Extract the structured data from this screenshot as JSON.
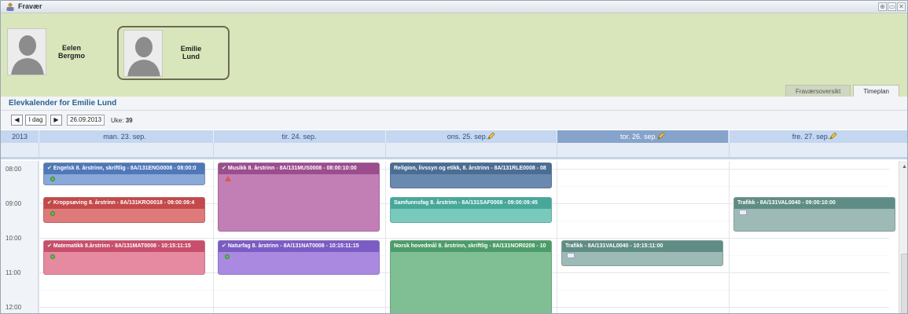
{
  "window": {
    "title": "Fravær",
    "buttons": [
      "⊕",
      "▭",
      "✕"
    ]
  },
  "students": [
    {
      "first": "Eelen",
      "last": "Bergmo"
    },
    {
      "first": "Emilie",
      "last": "Lund"
    }
  ],
  "tabs": [
    {
      "label": "Fraværsoversikt",
      "active": false
    },
    {
      "label": "Timeplan",
      "active": true
    }
  ],
  "calendar": {
    "title": "Elevkalender for Emilie Lund",
    "prev_icon": "◀",
    "today_label": "I dag",
    "next_icon": "▶",
    "date_value": "26.09.2013",
    "week_label": "Uke:",
    "week_number": "39",
    "year": "2013",
    "days": [
      {
        "label": "man. 23. sep.",
        "edit": false,
        "selected": false
      },
      {
        "label": "tir. 24. sep.",
        "edit": false,
        "selected": false
      },
      {
        "label": "ons. 25. sep.",
        "edit": true,
        "selected": false
      },
      {
        "label": "tor. 26. sep.",
        "edit": true,
        "selected": true
      },
      {
        "label": "fre. 27. sep.",
        "edit": true,
        "selected": false
      }
    ],
    "times": [
      "08:00",
      "09:00",
      "10:00",
      "11:00",
      "12:00"
    ]
  },
  "events": [
    {
      "day": 0,
      "start": "08:00",
      "end": "08:40",
      "check": true,
      "icon": "status-ok",
      "title": "Engelsk 8. årstrinn, skriftlig - 8A/131ENG0008 - 08:00:0",
      "bar": "#4f78b8",
      "body": "#8aa8d8"
    },
    {
      "day": 0,
      "start": "09:00",
      "end": "09:45",
      "check": true,
      "icon": "status-ok",
      "title": "Kroppsøving 8. årstrinn - 8A/131KRO0018 - 09:00:09:4",
      "bar": "#c4494a",
      "body": "#df7a7a"
    },
    {
      "day": 0,
      "start": "10:15",
      "end": "11:15",
      "check": true,
      "icon": "status-ok",
      "title": "Matematikk 8.årstrinn - 8A/131MAT0008 - 10:15:11:15",
      "bar": "#c84e6c",
      "body": "#e58aa1"
    },
    {
      "day": 1,
      "start": "08:00",
      "end": "10:00",
      "check": true,
      "icon": "warning",
      "title": "Musikk 8. årstrinn - 8A/131MUS0008 - 08:00:10:00",
      "bar": "#9b4d8e",
      "body": "#c27fb6"
    },
    {
      "day": 1,
      "start": "10:15",
      "end": "11:15",
      "check": true,
      "icon": "status-ok",
      "title": "Naturfag 8. årstrinn - 8A/131NAT0008 - 10:15:11:15",
      "bar": "#7b5bc4",
      "body": "#a98ae0"
    },
    {
      "day": 2,
      "start": "08:00",
      "end": "08:45",
      "check": false,
      "icon": "",
      "title": "Religion, livssyn og etikk, 8. årstrinn - 8A/131RLE0008 - 08",
      "bar": "#4b6d94",
      "body": "#6a89ae"
    },
    {
      "day": 2,
      "start": "09:00",
      "end": "09:45",
      "check": false,
      "icon": "",
      "title": "Samfunnsfag 8. årstrinn - 8A/131SAF0008 - 09:00:09:45",
      "bar": "#47a89a",
      "body": "#79c9bd"
    },
    {
      "day": 2,
      "start": "10:15",
      "end": "12:45",
      "check": false,
      "icon": "",
      "title": "Norsk hovedmål 8. årstrinn, skriftlig - 8A/131NOR0208 - 10",
      "bar": "#4c9c6a",
      "body": "#7fbf93"
    },
    {
      "day": 3,
      "start": "10:15",
      "end": "11:00",
      "check": false,
      "icon": "mail",
      "title": "Trafikk - 8A/131VAL0040 - 10:15:11:00",
      "bar": "#5f8d86",
      "body": "#9dbab6"
    },
    {
      "day": 4,
      "start": "09:00",
      "end": "10:00",
      "check": false,
      "icon": "mail",
      "title": "Trafikk - 8A/131VAL0040 - 09:00:10:00",
      "bar": "#5f8d86",
      "body": "#9dbab6"
    }
  ]
}
